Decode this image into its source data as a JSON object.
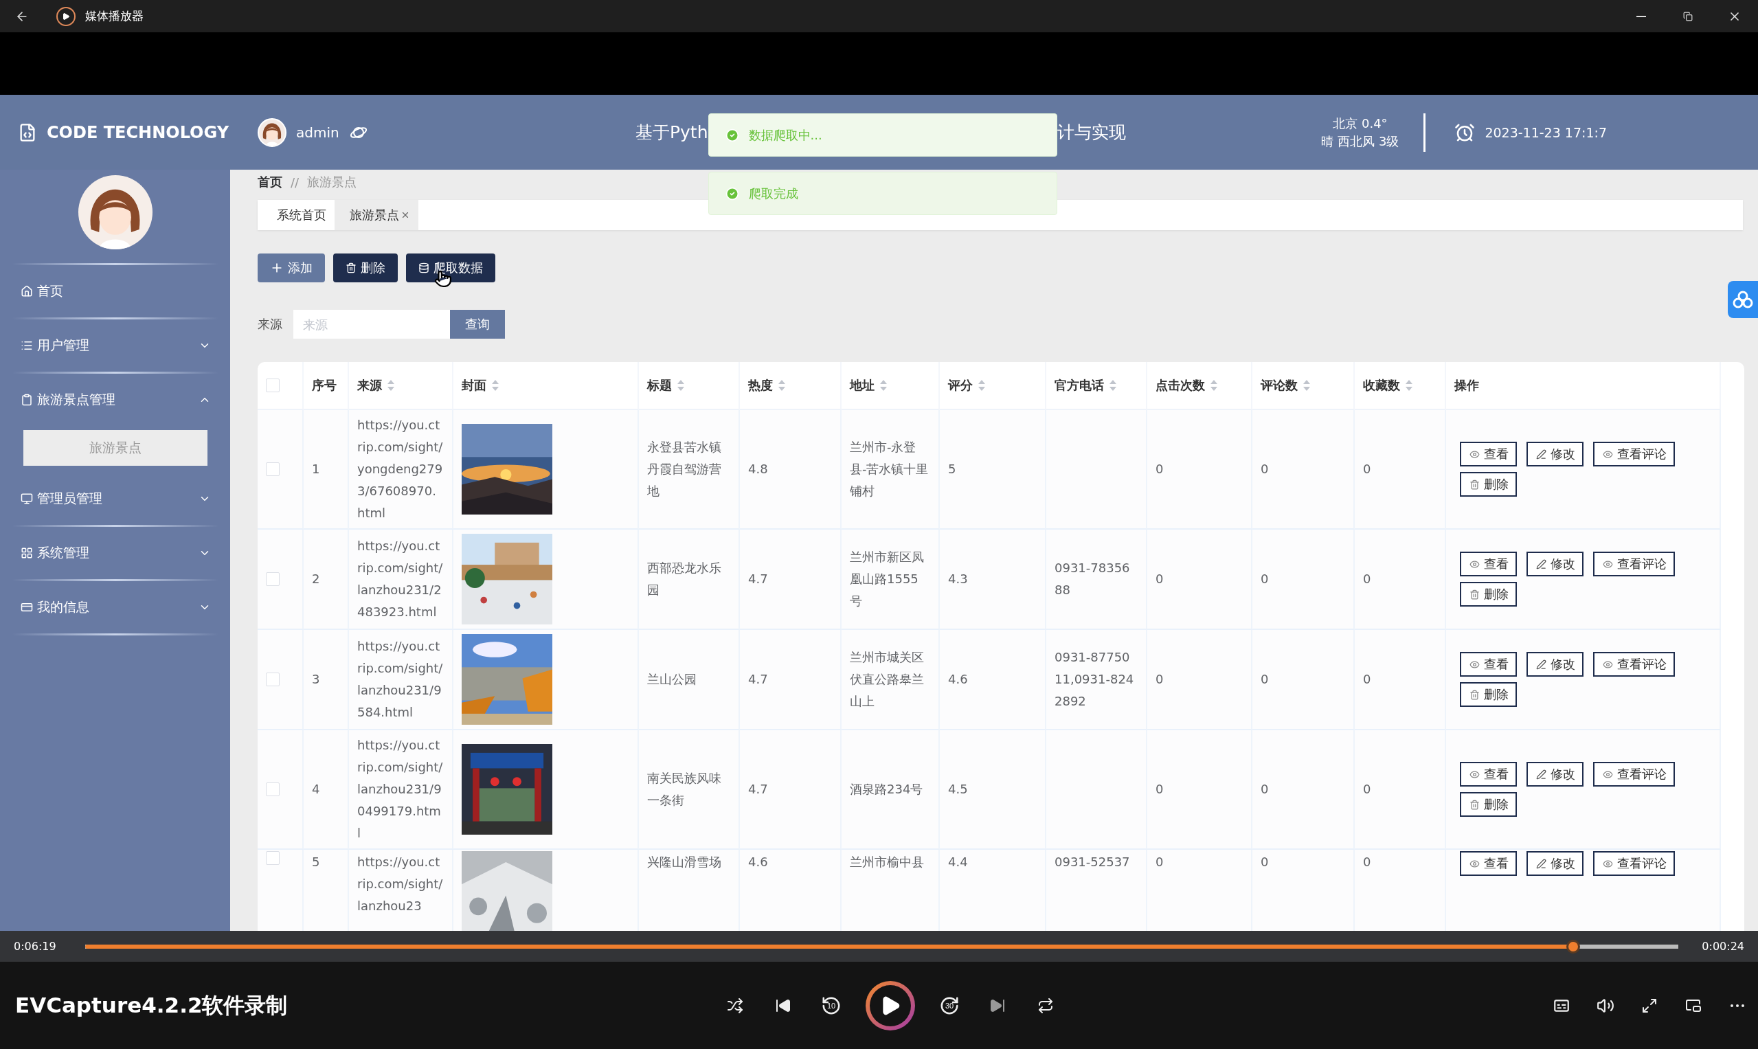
{
  "window": {
    "title": "媒体播放器"
  },
  "app": {
    "logo": "CODE TECHNOLOGY",
    "user": "admin",
    "title_parts": [
      "基于Pyth",
      "计与实现"
    ],
    "weather": {
      "line_1": "北京 0.4°",
      "line_2": "晴 西北风 3级"
    },
    "datetime": "2023-11-23 17:1:7"
  },
  "toasts": [
    {
      "text": "数据爬取中..."
    },
    {
      "text": "爬取完成"
    }
  ],
  "sidebar": {
    "items": [
      {
        "label": "首页"
      },
      {
        "label": "用户管理",
        "expanded": false
      },
      {
        "label": "旅游景点管理",
        "expanded": true,
        "children": [
          {
            "label": "旅游景点",
            "selected": true
          }
        ]
      },
      {
        "label": "管理员管理",
        "expanded": false
      },
      {
        "label": "系统管理",
        "expanded": false
      },
      {
        "label": "我的信息",
        "expanded": false
      }
    ]
  },
  "breadcrumb": [
    "首页",
    "//",
    "旅游景点"
  ],
  "tabs": [
    {
      "label": "系统首页",
      "selected": false,
      "closable": false
    },
    {
      "label": "旅游景点",
      "selected": true,
      "closable": true
    }
  ],
  "toolbar": [
    {
      "label": "添加",
      "kind": "add"
    },
    {
      "label": "删除",
      "kind": "delete"
    },
    {
      "label": "爬取数据",
      "kind": "crawl"
    }
  ],
  "search": {
    "label": "来源",
    "placeholder": "来源",
    "button": "查询"
  },
  "table": {
    "select_all": false,
    "columns": [
      {
        "label": "序号",
        "sortable": false
      },
      {
        "label": "来源",
        "sortable": true
      },
      {
        "label": "封面",
        "sortable": true
      },
      {
        "label": "标题",
        "sortable": true
      },
      {
        "label": "热度",
        "sortable": true
      },
      {
        "label": "地址",
        "sortable": true
      },
      {
        "label": "评分",
        "sortable": true
      },
      {
        "label": "官方电话",
        "sortable": true
      },
      {
        "label": "点击次数",
        "sortable": true
      },
      {
        "label": "评论数",
        "sortable": true
      },
      {
        "label": "收藏数",
        "sortable": true
      },
      {
        "label": "操作",
        "sortable": false
      }
    ],
    "rows": [
      {
        "checked": false,
        "index": "1",
        "source": "https://you.ctrip.com/sight/yongdeng2793/67608970.html",
        "title": "永登县苦水镇丹霞自驾游营地",
        "heat": "4.8",
        "address": "兰州市-永登县-苦水镇十里铺村",
        "rating": "5",
        "clicks": "0",
        "comments": "0",
        "favorites": "0",
        "actions": [
          {
            "label": "查看",
            "kind": "view"
          },
          {
            "label": "修改",
            "kind": "edit"
          },
          {
            "label": "查看评论",
            "kind": "comments"
          },
          {
            "label": "删除",
            "kind": "delete"
          }
        ]
      },
      {
        "checked": false,
        "index": "2",
        "source": "https://you.ctrip.com/sight/lanzhou231/2483923.html",
        "title": "西部恐龙水乐园",
        "heat": "4.7",
        "address": "兰州市新区凤凰山路1555号",
        "rating": "4.3",
        "phone": "0931-7835688",
        "clicks": "0",
        "comments": "0",
        "favorites": "0",
        "actions": [
          {
            "label": "查看",
            "kind": "view"
          },
          {
            "label": "修改",
            "kind": "edit"
          },
          {
            "label": "查看评论",
            "kind": "comments"
          },
          {
            "label": "删除",
            "kind": "delete"
          }
        ]
      },
      {
        "checked": false,
        "index": "3",
        "source": "https://you.ctrip.com/sight/lanzhou231/9584.html",
        "title": "兰山公园",
        "heat": "4.7",
        "address": "兰州市城关区伏直公路皋兰山上",
        "rating": "4.6",
        "phone": "0931-8775011,0931-8242892",
        "clicks": "0",
        "comments": "0",
        "favorites": "0",
        "actions": [
          {
            "label": "查看",
            "kind": "view"
          },
          {
            "label": "修改",
            "kind": "edit"
          },
          {
            "label": "查看评论",
            "kind": "comments"
          },
          {
            "label": "删除",
            "kind": "delete"
          }
        ]
      },
      {
        "checked": false,
        "index": "4",
        "source": "https://you.ctrip.com/sight/lanzhou231/90499179.html",
        "title": "南关民族风味一条街",
        "heat": "4.7",
        "address": "酒泉路234号",
        "rating": "4.5",
        "clicks": "0",
        "comments": "0",
        "favorites": "0",
        "actions": [
          {
            "label": "查看",
            "kind": "view"
          },
          {
            "label": "修改",
            "kind": "edit"
          },
          {
            "label": "查看评论",
            "kind": "comments"
          },
          {
            "label": "删除",
            "kind": "delete"
          }
        ]
      },
      {
        "checked": false,
        "index": "5",
        "source": "https://you.ctrip.com/sight/lanzhou23",
        "title": "兴隆山滑雪场",
        "heat": "4.6",
        "address": "兰州市榆中县",
        "rating": "4.4",
        "phone": "0931-52537",
        "clicks": "0",
        "comments": "0",
        "favorites": "0",
        "actions": [
          {
            "label": "查看",
            "kind": "view"
          },
          {
            "label": "修改",
            "kind": "edit"
          },
          {
            "label": "查看评论",
            "kind": "comments"
          }
        ]
      }
    ]
  },
  "player": {
    "elapsed": "0:06:19",
    "remaining": "0:00:24",
    "level": 0.934,
    "caption": "EVCapture4.2.2软件录制",
    "back_label": "10",
    "forward_label": "30"
  }
}
